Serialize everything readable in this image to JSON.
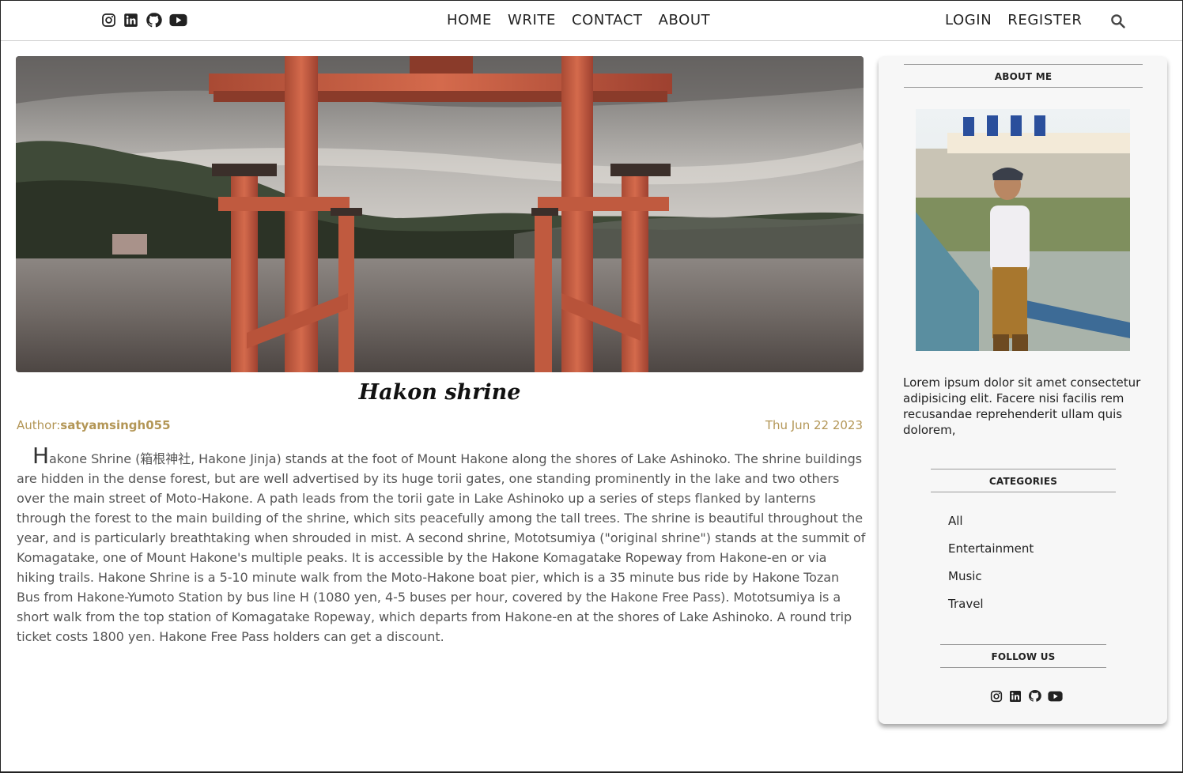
{
  "topbar": {
    "social_icons": [
      "instagram-icon",
      "linkedin-icon",
      "github-icon",
      "youtube-icon"
    ],
    "nav": [
      "HOME",
      "WRITE",
      "CONTACT",
      "ABOUT"
    ],
    "auth": {
      "login": "LOGIN",
      "register": "REGISTER"
    },
    "search_icon": "search-icon"
  },
  "post": {
    "title": "Hakon shrine",
    "author_label": "Author:",
    "author": "satyamsingh055",
    "date": "Thu Jun 22 2023",
    "drop_letter": "H",
    "body": "akone Shrine (箱根神社, Hakone Jinja) stands at the foot of Mount Hakone along the shores of Lake Ashinoko. The shrine buildings are hidden in the dense forest, but are well advertised by its huge torii gates, one standing prominently in the lake and two others over the main street of Moto-Hakone. A path leads from the torii gate in Lake Ashinoko up a series of steps flanked by lanterns through the forest to the main building of the shrine, which sits peacefully among the tall trees. The shrine is beautiful throughout the year, and is particularly breathtaking when shrouded in mist. A second shrine, Mototsumiya (\"original shrine\") stands at the summit of Komagatake, one of Mount Hakone's multiple peaks. It is accessible by the Hakone Komagatake Ropeway from Hakone-en or via hiking trails. Hakone Shrine is a 5-10 minute walk from the Moto-Hakone boat pier, which is a 35 minute bus ride by Hakone Tozan Bus from Hakone-Yumoto Station by bus line H (1080 yen, 4-5 buses per hour, covered by the Hakone Free Pass). Mototsumiya is a short walk from the top station of Komagatake Ropeway, which departs from Hakone-en at the shores of Lake Ashinoko. A round trip ticket costs 1800 yen. Hakone Free Pass holders can get a discount."
  },
  "sidebar": {
    "about_title": "ABOUT ME",
    "about_text": "Lorem ipsum dolor sit amet consectetur adipisicing elit. Facere nisi facilis rem recusandae reprehenderit ullam quis dolorem,",
    "categories_title": "CATEGORIES",
    "categories": [
      "All",
      "Entertainment",
      "Music",
      "Travel"
    ],
    "follow_title": "FOLLOW US"
  },
  "colors": {
    "accent": "#b39656",
    "text": "#555555",
    "sidebar_bg": "#f7f7f7"
  }
}
